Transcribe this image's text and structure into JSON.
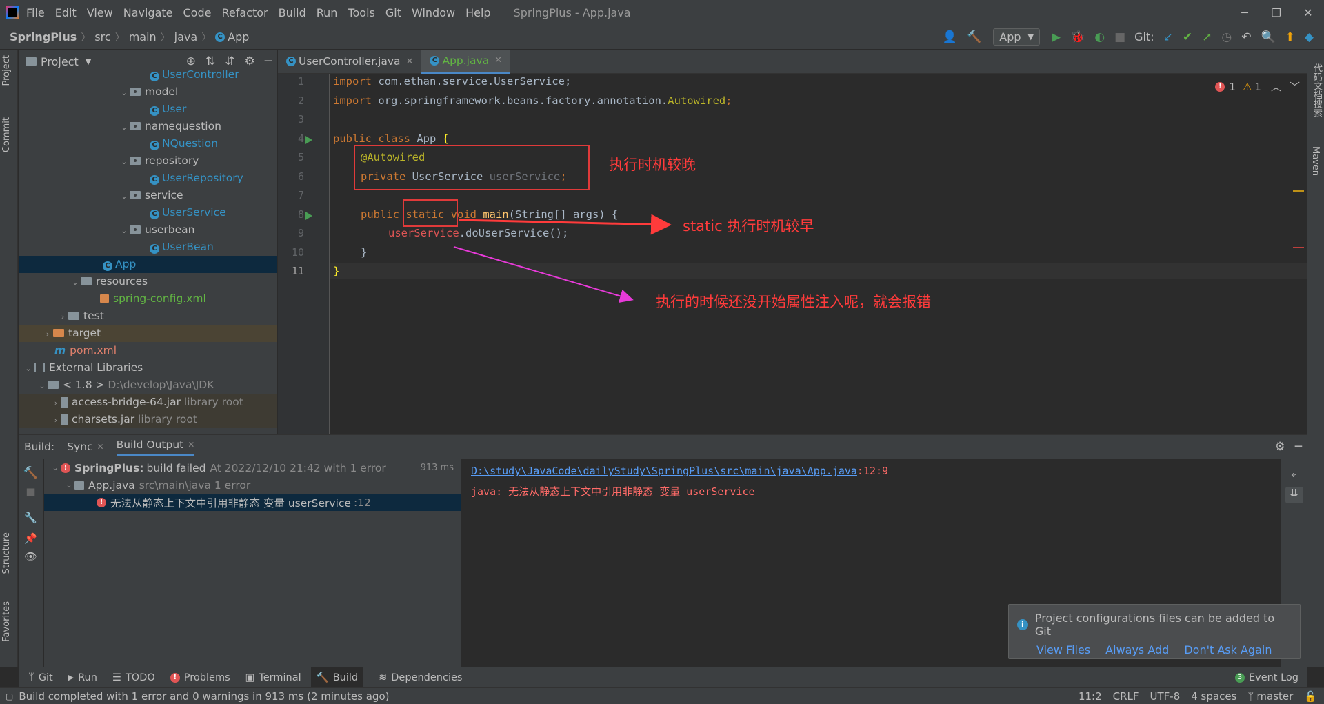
{
  "window": {
    "title": "SpringPlus - App.java",
    "menu": [
      "File",
      "Edit",
      "View",
      "Navigate",
      "Code",
      "Refactor",
      "Build",
      "Run",
      "Tools",
      "Git",
      "Window",
      "Help"
    ]
  },
  "navbar": {
    "crumbs": [
      "SpringPlus",
      "src",
      "main",
      "java",
      "App"
    ],
    "run_config": "App",
    "git_label": "Git:"
  },
  "stripes": {
    "left": [
      "Project",
      "Commit",
      "Structure",
      "Favorites"
    ],
    "right": [
      "代码文档搜索",
      "Maven"
    ]
  },
  "project": {
    "title": "Project",
    "items": [
      {
        "label": "UserController",
        "kind": "java"
      },
      {
        "label": "model",
        "kind": "package"
      },
      {
        "label": "User",
        "kind": "java"
      },
      {
        "label": "namequestion",
        "kind": "package"
      },
      {
        "label": "NQuestion",
        "kind": "java"
      },
      {
        "label": "repository",
        "kind": "package"
      },
      {
        "label": "UserRepository",
        "kind": "java"
      },
      {
        "label": "service",
        "kind": "package"
      },
      {
        "label": "UserService",
        "kind": "java"
      },
      {
        "label": "userbean",
        "kind": "package"
      },
      {
        "label": "UserBean",
        "kind": "java"
      },
      {
        "label": "App",
        "kind": "java"
      },
      {
        "label": "resources",
        "kind": "folder"
      },
      {
        "label": "spring-config.xml",
        "kind": "xml"
      },
      {
        "label": "test",
        "kind": "folder"
      },
      {
        "label": "target",
        "kind": "folder"
      },
      {
        "label": "pom.xml",
        "kind": "pom"
      },
      {
        "label": "External Libraries",
        "kind": "libs"
      },
      {
        "label": "< 1.8 >",
        "extra": "D:\\develop\\Java\\JDK",
        "kind": "jdk"
      },
      {
        "label": "access-bridge-64.jar",
        "extra": "library root",
        "kind": "jar"
      },
      {
        "label": "charsets.jar",
        "extra": "library root",
        "kind": "jar"
      }
    ]
  },
  "editor": {
    "tabs": [
      {
        "label": "UserController.java"
      },
      {
        "label": "App.java"
      }
    ],
    "line_numbers": [
      "1",
      "2",
      "3",
      "4",
      "5",
      "6",
      "7",
      "8",
      "9",
      "10",
      "11"
    ],
    "code": {
      "l1_kw": "import",
      "l1_rest": " com.ethan.service.UserService;",
      "l2_kw": "import",
      "l2_rest": " org.springframework.beans.factory.annotation.",
      "l2_ann": "Autowired",
      "l2_end": ";",
      "l4_kw": "public class",
      "l4_rest": " App ",
      "l4_brace": "{",
      "l5": "@Autowired",
      "l6_kw": "private",
      "l6_type": " UserService ",
      "l6_fld": "userService",
      "l6_end": ";",
      "l8_kw1": "public",
      "l8_kw2": " static void",
      "l8_fn": " main",
      "l8_rest": "(String[] args) {",
      "l9_fld": "userService",
      "l9_rest": ".doUserService();",
      "l10": "}",
      "l11": "}"
    },
    "inspections": {
      "errors": "1",
      "warnings": "1"
    },
    "annotations": {
      "late": "执行时机较晚",
      "early": "static 执行时机较早",
      "error_note": "执行的时候还没开始属性注入呢，就会报错"
    }
  },
  "build": {
    "label": "Build:",
    "tabs": [
      "Sync",
      "Build Output"
    ],
    "tree": {
      "root_name": "SpringPlus:",
      "root_status": "build failed",
      "root_detail": "At 2022/12/10 21:42 with 1 error",
      "root_time": "913 ms",
      "file_name": "App.java",
      "file_detail": "src\\main\\java 1 error",
      "error_msg": "无法从静态上下文中引用非静态 变量 userService",
      "error_line": ":12"
    },
    "output": {
      "path": "D:\\study\\JavaCode\\dailyStudy\\SpringPlus\\src\\main\\java\\App.java",
      "pos": ":12:9",
      "message": "java: 无法从静态上下文中引用非静态 变量 userService"
    }
  },
  "notification": {
    "text": "Project configurations files can be added to Git",
    "actions": [
      "View Files",
      "Always Add",
      "Don't Ask Again"
    ]
  },
  "bottom_tools": [
    "Git",
    "Run",
    "TODO",
    "Problems",
    "Terminal",
    "Build",
    "Dependencies"
  ],
  "event_log": {
    "count": "3",
    "label": "Event Log"
  },
  "status": {
    "message": "Build completed with 1 error and 0 warnings in 913 ms (2 minutes ago)",
    "position": "11:2",
    "line_sep": "CRLF",
    "encoding": "UTF-8",
    "indent": "4 spaces",
    "branch": "master"
  },
  "colors": {
    "annotation_red": "#ff3b3b",
    "arrow_magenta": "#e83ad9",
    "accent_blue": "#4a88c7"
  }
}
